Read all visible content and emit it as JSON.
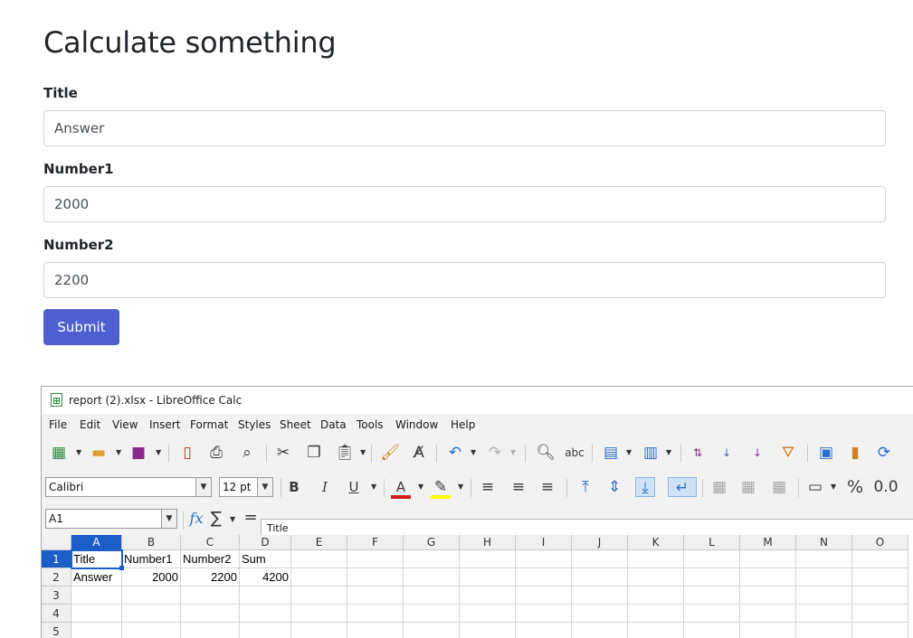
{
  "form": {
    "title": "Calculate something",
    "fields": [
      {
        "label": "Title",
        "value": "Answer"
      },
      {
        "label": "Number1",
        "value": "2000"
      },
      {
        "label": "Number2",
        "value": "2200"
      }
    ],
    "submit_label": "Submit"
  },
  "calc": {
    "window_title": "report (2).xlsx - LibreOffice Calc",
    "menu": [
      "File",
      "Edit",
      "View",
      "Insert",
      "Format",
      "Styles",
      "Sheet",
      "Data",
      "Tools",
      "Window",
      "Help"
    ],
    "font_name": "Calibri",
    "font_size": "12 pt",
    "name_box": "A1",
    "formula": "Title",
    "columns": [
      "A",
      "B",
      "C",
      "D",
      "E",
      "F",
      "G",
      "H",
      "I",
      "J",
      "K",
      "L",
      "M",
      "N",
      "O"
    ],
    "rows": [
      "1",
      "2",
      "3",
      "4",
      "5"
    ],
    "cells": {
      "A1": "Title",
      "B1": "Number1",
      "C1": "Number2",
      "D1": "Sum",
      "A2": "Answer",
      "B2": "2000",
      "C2": "2200",
      "D2": "4200"
    },
    "toolbar_glyphs": {
      "fx": "fx",
      "sigma": "∑",
      "equals": "=",
      "bold": "B",
      "italic": "I",
      "underline": "U",
      "percent": "%",
      "decimal": "0.0",
      "font_color_letter": "A"
    },
    "colors": {
      "selection": "#1c5ec8",
      "font_color": "#c9211e",
      "highlight": "#ffff00"
    }
  }
}
